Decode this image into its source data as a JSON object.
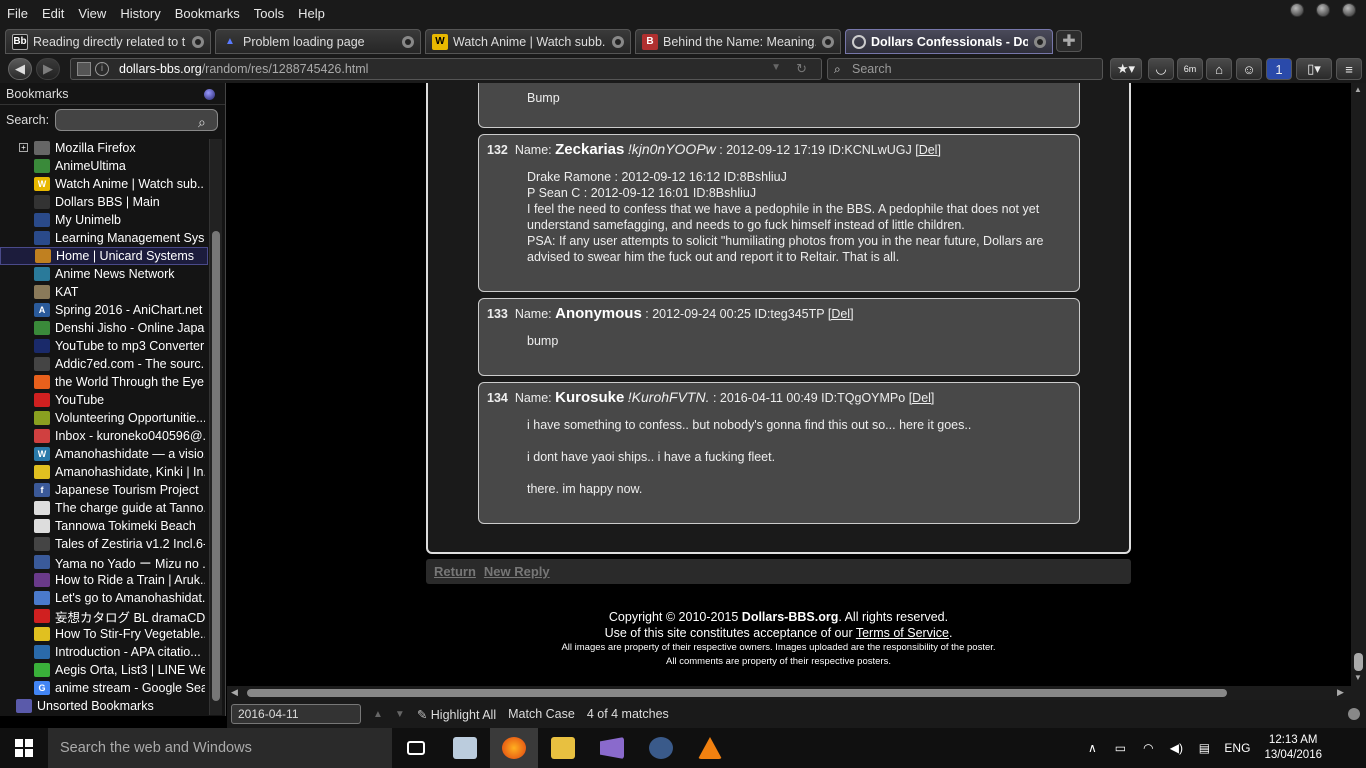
{
  "menubar": {
    "items": [
      "File",
      "Edit",
      "View",
      "History",
      "Bookmarks",
      "Tools",
      "Help"
    ]
  },
  "tabs": [
    {
      "title": "Reading directly related to t...",
      "icon_text": "Bb",
      "icon_color": "#1a1a1a",
      "icon": "bb-icon"
    },
    {
      "title": "Problem loading page",
      "icon_text": "▲",
      "icon_color": "#1a2a6a",
      "icon": "warning-icon"
    },
    {
      "title": "Watch Anime | Watch subb...",
      "icon_text": "W",
      "icon_color": "#e8b800",
      "icon": "watch-anime-icon"
    },
    {
      "title": "Behind the Name: Meaning...",
      "icon_text": "B",
      "icon_color": "#b03030",
      "icon": "behind-the-name-icon"
    },
    {
      "title": "Dollars Confessionals - Do...",
      "icon_text": "",
      "icon_color": "#222",
      "icon": "dollars-icon",
      "active": true
    }
  ],
  "navbar": {
    "url_host": "dollars-bbs.org",
    "url_path": "/random/res/1288745426.html",
    "search_placeholder": "Search"
  },
  "sidebar": {
    "title": "Bookmarks",
    "search_label": "Search:",
    "items": [
      {
        "label": "Mozilla Firefox",
        "icon": "folder-icon",
        "color": "#666",
        "folder": true
      },
      {
        "label": "AnimeUltima",
        "icon": "animeultima-icon",
        "color": "#3a8a3a"
      },
      {
        "label": "Watch Anime | Watch sub...",
        "icon": "watch-anime-icon",
        "color": "#e8b800",
        "text": "W"
      },
      {
        "label": "Dollars BBS | Main",
        "icon": "dollars-icon",
        "color": "#333"
      },
      {
        "label": "My Unimelb",
        "icon": "unimelb-icon",
        "color": "#2a4a8a"
      },
      {
        "label": "Learning Management Sys...",
        "icon": "lms-icon",
        "color": "#2a4a8a"
      },
      {
        "label": "Home | Unicard Systems",
        "icon": "unicard-icon",
        "color": "#c08020",
        "selected": true
      },
      {
        "label": "Anime News Network",
        "icon": "ann-icon",
        "color": "#2a7a9a"
      },
      {
        "label": "KAT",
        "icon": "kat-icon",
        "color": "#8a7a5a"
      },
      {
        "label": "Spring 2016 - AniChart.net ...",
        "icon": "anichart-icon",
        "color": "#2a5a9a",
        "text": "A"
      },
      {
        "label": "Denshi Jisho - Online Japa...",
        "icon": "jisho-icon",
        "color": "#3a8a3a"
      },
      {
        "label": "YouTube to mp3 Converter",
        "icon": "ytmp3-icon",
        "color": "#1a2a6a"
      },
      {
        "label": "Addic7ed.com - The sourc...",
        "icon": "addic7ed-icon",
        "color": "#444"
      },
      {
        "label": "the World Through the Eye...",
        "icon": "blogger-icon",
        "color": "#e8601c"
      },
      {
        "label": "YouTube",
        "icon": "youtube-icon",
        "color": "#d02020"
      },
      {
        "label": "Volunteering Opportunitie...",
        "icon": "volunteering-icon",
        "color": "#8aa020"
      },
      {
        "label": "Inbox - kuroneko040596@...",
        "icon": "gmail-icon",
        "color": "#d04040"
      },
      {
        "label": "Amanohashidate — a visio...",
        "icon": "wordpress-icon",
        "color": "#2a7aaa",
        "text": "W"
      },
      {
        "label": "Amanohashidate, Kinki | In...",
        "icon": "insidejapan-icon",
        "color": "#e0c020"
      },
      {
        "label": "Japanese Tourism Project",
        "icon": "facebook-icon",
        "color": "#3b5998",
        "text": "f"
      },
      {
        "label": "The charge guide at Tanno...",
        "icon": "page-icon",
        "color": "#ddd"
      },
      {
        "label": "Tannowa Tokimeki Beach",
        "icon": "page-icon",
        "color": "#ddd"
      },
      {
        "label": "Tales of Zestiria v1.2 Incl.6-...",
        "icon": "torrent-icon",
        "color": "#444"
      },
      {
        "label": "Yama no Yado ー Mizu no ...",
        "icon": "yado-icon",
        "color": "#3a5a9a"
      },
      {
        "label": "How to Ride a Train | Aruk...",
        "icon": "aruku-icon",
        "color": "#6a3a8a"
      },
      {
        "label": "Let's go to Amanohashidat...",
        "icon": "gotrip-icon",
        "color": "#4a7acc"
      },
      {
        "label": "妄想カタログ BL dramaCD【...",
        "icon": "youtube-icon",
        "color": "#d02020"
      },
      {
        "label": "How To Stir-Fry Vegetable...",
        "icon": "recipe-icon",
        "color": "#e0c020"
      },
      {
        "label": "Introduction - APA citatio...",
        "icon": "apa-icon",
        "color": "#2a6aaa"
      },
      {
        "label": "Aegis Orta, List3 | LINE We...",
        "icon": "line-icon",
        "color": "#3ab03a"
      },
      {
        "label": "anime stream - Google Sea...",
        "icon": "google-icon",
        "color": "#4285f4",
        "text": "G"
      },
      {
        "label": "Unsorted Bookmarks",
        "icon": "unsorted-bookmarks-icon",
        "color": "#5a5aaa",
        "root": true
      }
    ]
  },
  "posts": [
    {
      "body": [
        "Bump"
      ]
    },
    {
      "num": "132",
      "name_label": "Name:",
      "name": "Zeckarias",
      "trip": "!kjn0nYOOPw",
      "meta": ": 2012-09-12 17:19 ID:KCNLwUGJ",
      "del": "[Del]",
      "body": [
        "Drake Ramone : 2012-09-12 16:12 ID:8BshliuJ",
        "P Sean C : 2012-09-12 16:01 ID:8BshliuJ",
        "I feel the need to confess that we have a pedophile in the BBS. A pedophile that does not yet understand samefagging, and needs to go fuck himself instead of little children.",
        "PSA: If any user attempts to solicit \"humiliating photos from you in the near future, Dollars are advised to swear him the fuck out and report it to Reltair. That is all."
      ]
    },
    {
      "num": "133",
      "name_label": "Name:",
      "name": "Anonymous",
      "trip": "",
      "meta": ": 2012-09-24 00:25 ID:teg345TP",
      "del": "[Del]",
      "body": [
        "bump"
      ]
    },
    {
      "num": "134",
      "name_label": "Name:",
      "name": "Kurosuke",
      "trip": "!KurohFVTN.",
      "meta": ": 2016-04-11 00:49 ID:TQgOYMPo",
      "del": "[Del]",
      "body": [
        "i have something to confess.. but nobody's gonna find this out so... here it goes..",
        "",
        "i dont have yaoi ships.. i have a fucking fleet.",
        "",
        "there. im happy now."
      ]
    }
  ],
  "reply_bar": {
    "return": "Return",
    "new_reply": "New Reply"
  },
  "footer": {
    "copyright_prefix": "Copyright © 2010-2015 ",
    "site": "Dollars-BBS.org",
    "copyright_suffix": ". All rights reserved.",
    "use_prefix": "Use of this site constitutes acceptance of our ",
    "tos": "Terms of Service",
    "use_suffix": ".",
    "images_note": "All images are property of their respective owners. Images uploaded are the responsibility of the poster.",
    "comments_note": "All comments are property of their respective posters."
  },
  "findbar": {
    "query": "2016-04-11",
    "highlight_all": "Highlight All",
    "match_case": "Match Case",
    "matches": "4 of 4 matches"
  },
  "taskbar": {
    "search_placeholder": "Search the web and Windows",
    "language": "ENG",
    "time": "12:13 AM",
    "date": "13/04/2016"
  }
}
